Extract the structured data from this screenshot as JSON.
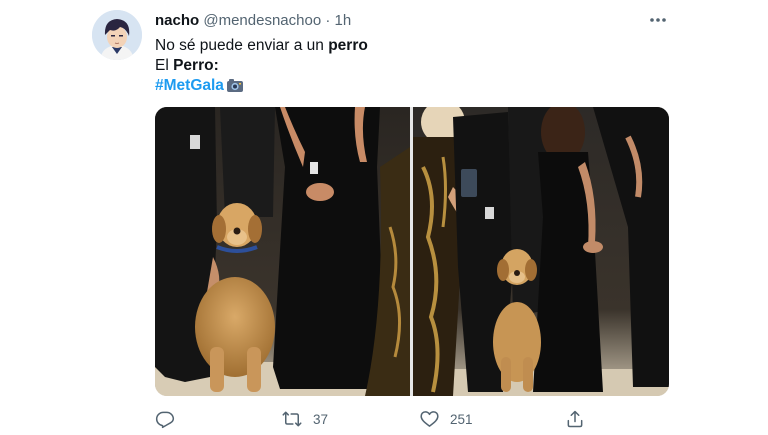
{
  "tweet": {
    "author": {
      "display_name": "nacho",
      "handle": "@mendesnachoo",
      "separator": "·",
      "time": "1h"
    },
    "text": {
      "line1_prefix": "No sé puede enviar a un ",
      "line1_bold": "perro",
      "line2_prefix": "El ",
      "line2_bold": "Perro",
      "line2_suffix": ":",
      "hashtag": "#MetGala",
      "emoji": "camera-emoji"
    },
    "media": {
      "images": [
        {
          "name": "photo-dog-sitting-at-met-gala"
        },
        {
          "name": "photo-guests-standing-with-dog"
        }
      ]
    },
    "actions": {
      "reply": {
        "icon": "reply-icon",
        "count": ""
      },
      "retweet": {
        "icon": "retweet-icon",
        "count": "37"
      },
      "like": {
        "icon": "heart-icon",
        "count": "251"
      },
      "share": {
        "icon": "share-icon",
        "count": ""
      }
    },
    "colors": {
      "accent": "#1d9bf0",
      "secondary_text": "#536471",
      "primary_text": "#0f1419"
    }
  }
}
